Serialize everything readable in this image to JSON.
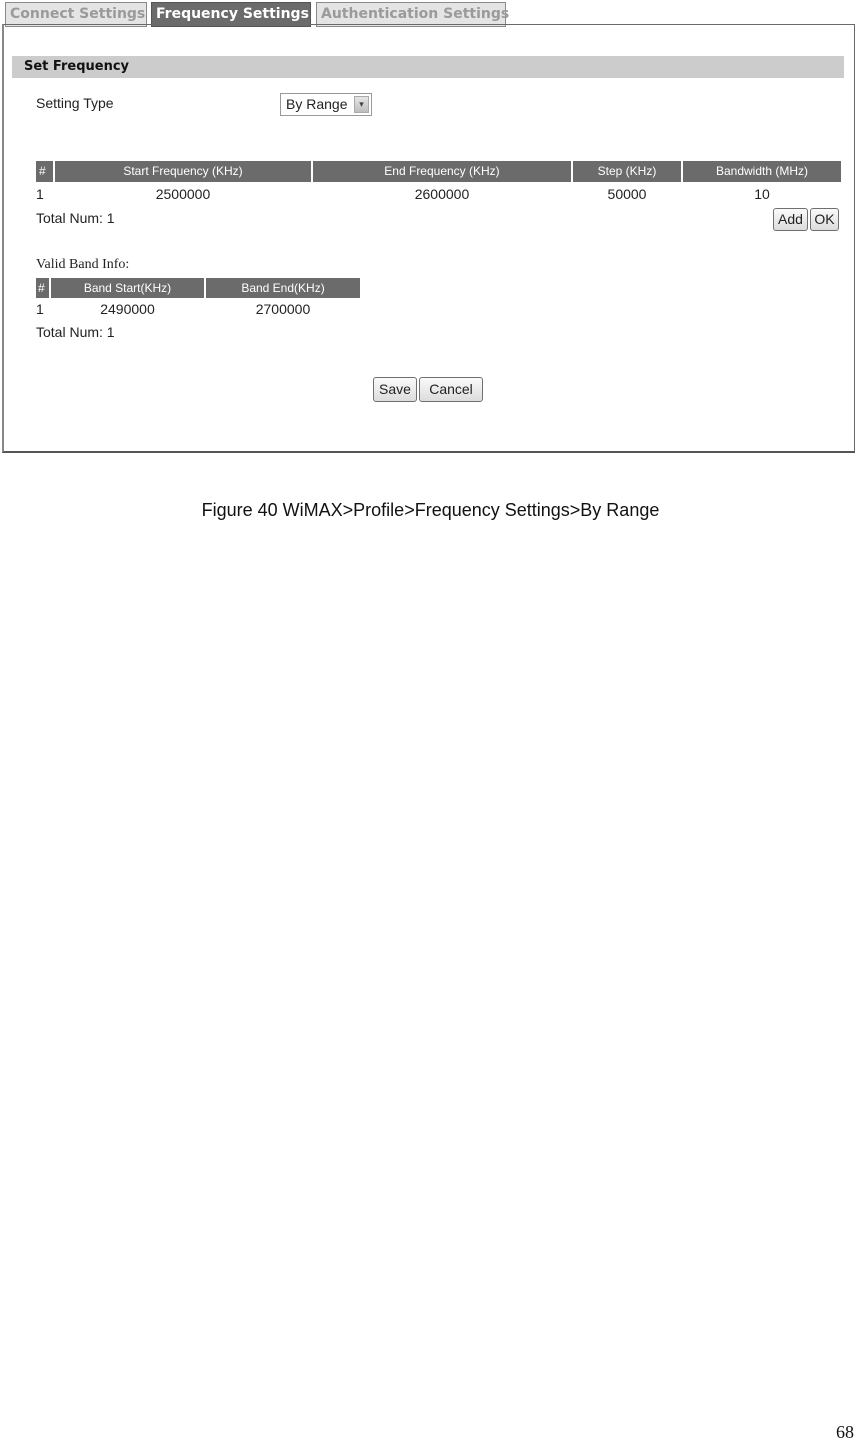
{
  "tabs": [
    {
      "label": "Connect Settings",
      "active": false
    },
    {
      "label": "Frequency Settings",
      "active": true
    },
    {
      "label": "Authentication Settings",
      "active": false
    }
  ],
  "section": {
    "title": "Set Frequency",
    "setting_type_label": "Setting Type",
    "setting_type_value": "By Range",
    "setting_type_arrow": "▾"
  },
  "frequency_table": {
    "headers": [
      "#",
      "Start Frequency (KHz)",
      "End Frequency (KHz)",
      "Step (KHz)",
      "Bandwidth (MHz)"
    ],
    "rows": [
      [
        "1",
        "2500000",
        "2600000",
        "50000",
        "10"
      ]
    ],
    "total": "Total Num: 1",
    "add_label": "Add",
    "ok_label": "OK"
  },
  "band_info": {
    "title": "Valid Band Info:",
    "headers": [
      "#",
      "Band Start(KHz)",
      "Band End(KHz)"
    ],
    "rows": [
      [
        "1",
        "2490000",
        "2700000"
      ]
    ],
    "total": "Total Num: 1"
  },
  "actions": {
    "save_label": "Save",
    "cancel_label": "Cancel"
  },
  "caption": "Figure 40  WiMAX>Profile>Frequency Settings>By Range",
  "page_number": "68"
}
